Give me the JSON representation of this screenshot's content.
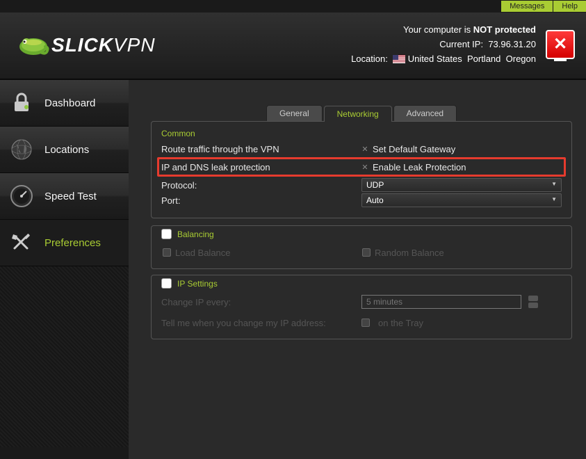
{
  "topbar": {
    "messages": "Messages",
    "help": "Help"
  },
  "logo": {
    "brand1": "SLICK",
    "brand2": "VPN"
  },
  "status": {
    "line1_a": "Your computer is ",
    "line1_b": "NOT protected",
    "ip_label": "Current IP:",
    "ip_value": "73.96.31.20",
    "loc_label": "Location:",
    "loc_country": "United States",
    "loc_city": "Portland",
    "loc_region": "Oregon"
  },
  "nav": {
    "dashboard": "Dashboard",
    "locations": "Locations",
    "speedtest": "Speed Test",
    "preferences": "Preferences"
  },
  "tabs": {
    "general": "General",
    "networking": "Networking",
    "advanced": "Advanced"
  },
  "common": {
    "title": "Common",
    "route_label": "Route traffic through the VPN",
    "route_value": "Set Default Gateway",
    "leak_label": "IP and DNS leak protection",
    "leak_value": "Enable Leak Protection",
    "protocol_label": "Protocol:",
    "protocol_value": "UDP",
    "port_label": "Port:",
    "port_value": "Auto"
  },
  "balancing": {
    "title": "Balancing",
    "load": "Load Balance",
    "random": "Random Balance"
  },
  "ip": {
    "title": "IP Settings",
    "change_label": "Change IP every:",
    "change_placeholder": "5 minutes",
    "tell_label": "Tell me when you change my IP address:",
    "tell_value": "on the Tray"
  }
}
